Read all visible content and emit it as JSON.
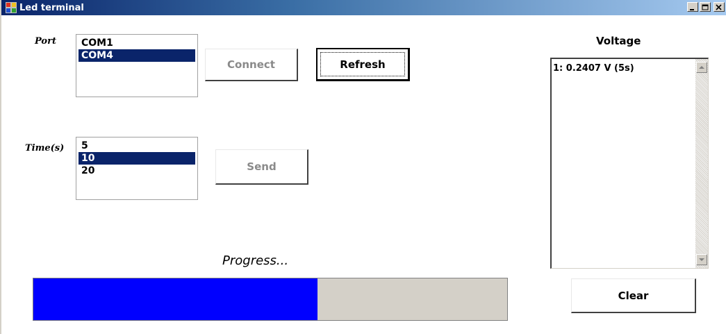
{
  "window": {
    "title": "Led terminal"
  },
  "port": {
    "label": "Port",
    "items": [
      {
        "label": "COM1",
        "selected": false
      },
      {
        "label": "COM4",
        "selected": true
      }
    ]
  },
  "time": {
    "label": "Time(s)",
    "items": [
      {
        "label": "5",
        "selected": false
      },
      {
        "label": "10",
        "selected": true
      },
      {
        "label": "20",
        "selected": false
      }
    ]
  },
  "buttons": {
    "connect": "Connect",
    "refresh": "Refresh",
    "send": "Send",
    "clear": "Clear"
  },
  "voltage": {
    "title": "Voltage",
    "entries": [
      "1: 0.2407 V (5s)"
    ]
  },
  "progress": {
    "label": "Progress...",
    "percent": 60
  },
  "colors": {
    "selection": "#0a246a",
    "progress_fill": "#0000ff",
    "progress_track": "#d4d0c8"
  }
}
